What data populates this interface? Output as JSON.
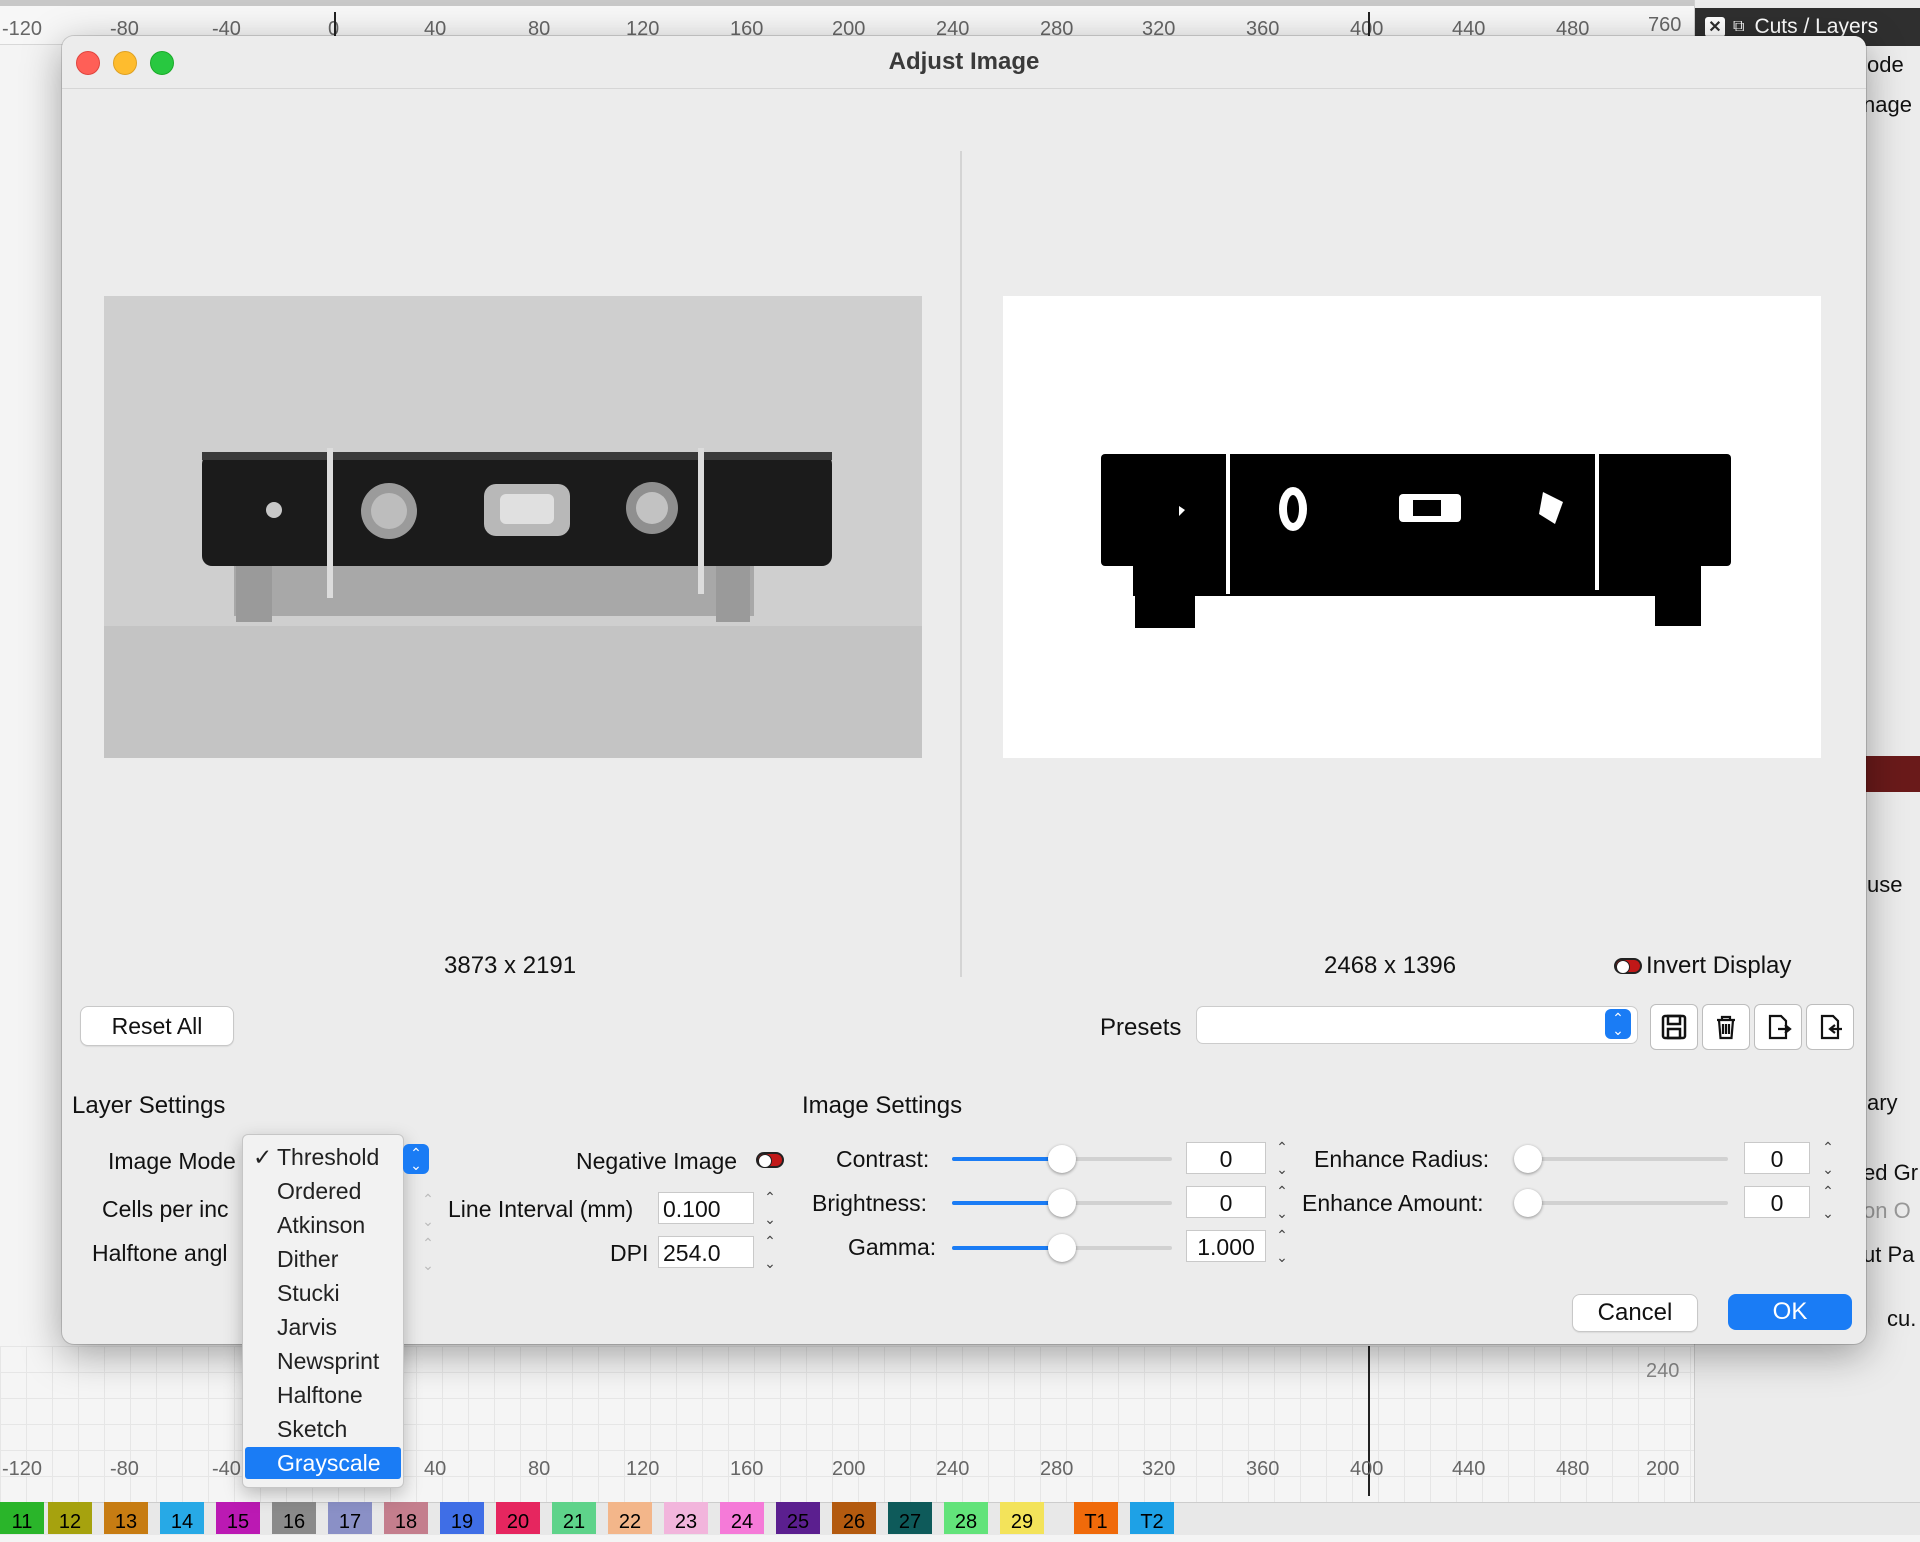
{
  "background": {
    "ruler_top_labels": [
      "-120",
      "-80",
      "-40",
      "0",
      "40",
      "80",
      "120",
      "160",
      "200",
      "240",
      "280",
      "320",
      "360",
      "400",
      "440",
      "480",
      "760"
    ],
    "ruler_bottom_labels": [
      "-120",
      "-80",
      "-40",
      "40",
      "80",
      "120",
      "160",
      "200",
      "240",
      "280",
      "320",
      "360",
      "400",
      "440",
      "480",
      "200"
    ],
    "canvas_label": "240",
    "right_panel": {
      "header": "Cuts / Layers",
      "texts": [
        "ode",
        "nage",
        "use",
        "ary",
        "ed Gr",
        "on O",
        "ut Pa",
        "cu."
      ]
    },
    "color_swatches": [
      {
        "label": "11",
        "color": "#2ab52a"
      },
      {
        "label": "12",
        "color": "#a6a20e"
      },
      {
        "label": "13",
        "color": "#c77c12"
      },
      {
        "label": "14",
        "color": "#27a9e6"
      },
      {
        "label": "15",
        "color": "#bb19b3"
      },
      {
        "label": "16",
        "color": "#8a8a8a"
      },
      {
        "label": "17",
        "color": "#8a90c6"
      },
      {
        "label": "18",
        "color": "#c47e8d"
      },
      {
        "label": "19",
        "color": "#3f6ee6"
      },
      {
        "label": "20",
        "color": "#e6265f"
      },
      {
        "label": "21",
        "color": "#5ed38a"
      },
      {
        "label": "22",
        "color": "#f3b68a"
      },
      {
        "label": "23",
        "color": "#f2b5dc"
      },
      {
        "label": "24",
        "color": "#f57ad8"
      },
      {
        "label": "25",
        "color": "#5b1f8f"
      },
      {
        "label": "26",
        "color": "#b35a0f"
      },
      {
        "label": "27",
        "color": "#0e5a5a"
      },
      {
        "label": "28",
        "color": "#62e37a"
      },
      {
        "label": "29",
        "color": "#f3e35a"
      },
      {
        "label": "T1",
        "color": "#f06a0a"
      },
      {
        "label": "T2",
        "color": "#1ea1e6"
      }
    ]
  },
  "dialog": {
    "title": "Adjust Image",
    "original_size": "3873 x 2191",
    "processed_size": "2468 x 1396",
    "invert_display_label": "Invert Display",
    "reset_all_label": "Reset All",
    "presets_label": "Presets",
    "presets_value": "",
    "layer_settings": {
      "heading": "Layer Settings",
      "image_mode_label": "Image Mode",
      "cells_per_inch_label": "Cells per inc",
      "halftone_angle_label": "Halftone angl",
      "negative_image_label": "Negative Image",
      "line_interval_label": "Line Interval (mm)",
      "line_interval_value": "0.100",
      "dpi_label": "DPI",
      "dpi_value": "254.0"
    },
    "image_settings": {
      "heading": "Image Settings",
      "contrast_label": "Contrast:",
      "contrast_value": "0",
      "contrast_level": 0.5,
      "brightness_label": "Brightness:",
      "brightness_value": "0",
      "brightness_level": 0.5,
      "gamma_label": "Gamma:",
      "gamma_value": "1.000",
      "gamma_level": 0.5,
      "enhance_radius_label": "Enhance Radius:",
      "enhance_radius_value": "0",
      "enhance_radius_level": 0,
      "enhance_amount_label": "Enhance Amount:",
      "enhance_amount_value": "0",
      "enhance_amount_level": 0
    },
    "cancel_label": "Cancel",
    "ok_label": "OK",
    "accent_color": "#1a7cf5"
  },
  "image_mode_menu": {
    "checked": "Threshold",
    "highlighted": "Grayscale",
    "items": [
      "Threshold",
      "Ordered",
      "Atkinson",
      "Dither",
      "Stucki",
      "Jarvis",
      "Newsprint",
      "Halftone",
      "Sketch",
      "Grayscale"
    ]
  }
}
